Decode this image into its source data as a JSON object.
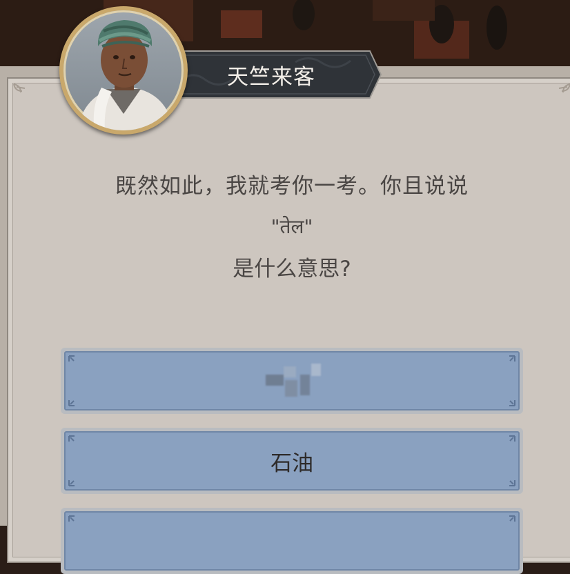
{
  "npc": {
    "name": "天竺来客",
    "avatar_icon": "turbaned-man-portrait-icon"
  },
  "dialogue": {
    "line1": "既然如此，我就考你一考。你且说说",
    "line2": "\"तेल\"",
    "line3": "是什么意思?"
  },
  "options": [
    {
      "label": ""
    },
    {
      "label": "石油"
    },
    {
      "label": ""
    }
  ],
  "colors": {
    "panel": "#cdc6bf",
    "option_fill": "#8aa1c0",
    "banner": "#2f3338",
    "text": "#4a4644"
  }
}
